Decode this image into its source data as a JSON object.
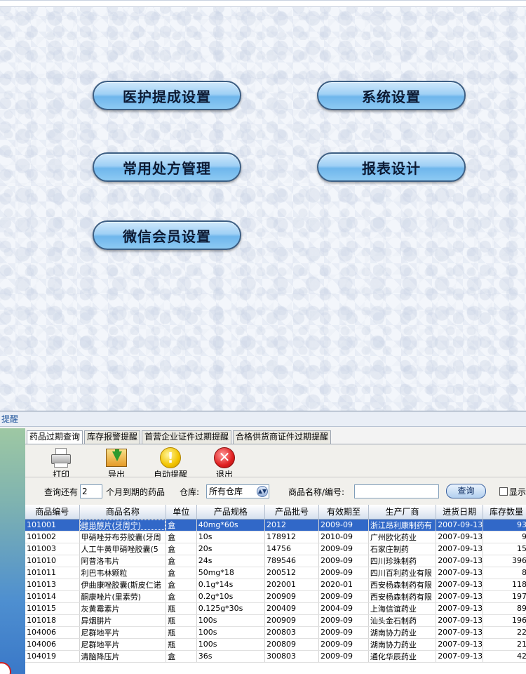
{
  "main_buttons": {
    "commission_settings": "医护提成设置",
    "system_settings": "系统设置",
    "prescription_management": "常用处方管理",
    "report_design": "报表设计",
    "wechat_member_settings": "微信会员设置"
  },
  "reminder_panel": {
    "title": "提醒",
    "tabs": [
      "药品过期查询",
      "库存报警提醒",
      "首营企业证件过期提醒",
      "合格供货商证件过期提醒"
    ],
    "toolbar": {
      "print": "打印",
      "export": "导出",
      "auto_remind": "自动提醒",
      "exit": "退出"
    },
    "filter": {
      "label_query_months": "查询还有",
      "months_value": "2",
      "label_expiring": "个月到期的药品",
      "label_warehouse": "仓库:",
      "warehouse_value": "所有仓库",
      "label_product": "商品名称/编号:",
      "product_value": "",
      "query_button": "查询",
      "checkbox_label": "显示"
    },
    "table": {
      "columns": [
        "商品编号",
        "商品名称",
        "单位",
        "产品规格",
        "产品批号",
        "有效期至",
        "生产厂商",
        "进货日期",
        "库存数量"
      ],
      "rows": [
        [
          "101001",
          "雌甾醇片(牙周宁)",
          "盒",
          "40mg*60s",
          "2012",
          "2009-09",
          "浙江昂利康制药有",
          "2007-09-13",
          "93"
        ],
        [
          "101002",
          "甲硝唑芬布芬胶囊(牙周",
          "盒",
          "10s",
          "178912",
          "2010-09",
          "广州欧化药业",
          "2007-09-13",
          "9"
        ],
        [
          "101003",
          "人工牛黄甲硝唑胶囊(5",
          "盒",
          "20s",
          "14756",
          "2009-09",
          "石家庄制药",
          "2007-09-13",
          "15"
        ],
        [
          "101010",
          "阿昔洛韦片",
          "盒",
          "24s",
          "789546",
          "2009-09",
          "四川珍珠制药",
          "2007-09-13",
          "396"
        ],
        [
          "101011",
          "利巴韦林颗粒",
          "盒",
          "50mg*18",
          "200512",
          "2009-09",
          "四川百利药业有限",
          "2007-09-13",
          "8"
        ],
        [
          "101013",
          "伊曲康唑胶囊(斯皮仁诺",
          "盒",
          "0.1g*14s",
          "202001",
          "2020-01",
          "西安杨森制药有限",
          "2007-09-13",
          "118"
        ],
        [
          "101014",
          "酮康唑片(里素劳)",
          "盒",
          "0.2g*10s",
          "200909",
          "2009-09",
          "西安杨森制药有限",
          "2007-09-13",
          "197"
        ],
        [
          "101015",
          "灰黄霉素片",
          "瓶",
          "0.125g*30s",
          "200409",
          "2004-09",
          "上海信谊药业",
          "2007-09-13",
          "89"
        ],
        [
          "101018",
          "异烟肼片",
          "瓶",
          "100s",
          "200909",
          "2009-09",
          "汕头金石制药",
          "2007-09-13",
          "196"
        ],
        [
          "104006",
          "尼群地平片",
          "瓶",
          "100s",
          "200803",
          "2009-09",
          "湖南协力药业",
          "2007-09-13",
          "22"
        ],
        [
          "104006",
          "尼群地平片",
          "瓶",
          "100s",
          "200809",
          "2009-09",
          "湖南协力药业",
          "2007-09-13",
          "21"
        ],
        [
          "104019",
          "清脑降压片",
          "盒",
          "36s",
          "300803",
          "2009-09",
          "通化华辰药业",
          "2007-09-13",
          "42"
        ]
      ],
      "selected_row": 0
    }
  }
}
